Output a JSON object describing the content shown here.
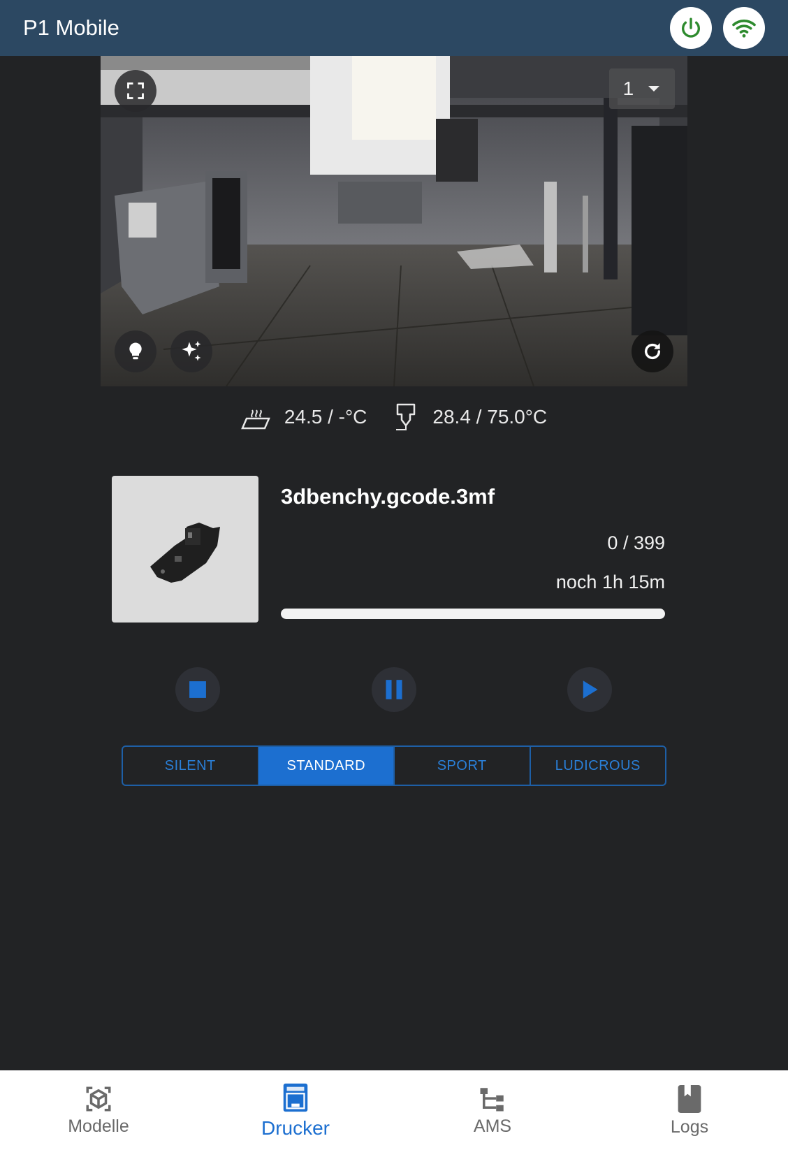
{
  "app": {
    "title": "P1 Mobile"
  },
  "status": {
    "power_icon": "power-icon",
    "wifi_icon": "wifi-icon",
    "color": "#2e8b2e"
  },
  "camera": {
    "selected_camera": "1",
    "buttons": [
      "fullscreen-icon",
      "lightbulb-icon",
      "sparkle-icon",
      "refresh-icon"
    ]
  },
  "temps": {
    "bed": "24.5 / -°C",
    "nozzle": "28.4 / 75.0°C"
  },
  "job": {
    "file_name": "3dbenchy.gcode.3mf",
    "layers": "0 / 399",
    "remaining": "noch 1h 15m",
    "progress": 0
  },
  "controls": [
    "stop-icon",
    "pause-icon",
    "play-icon"
  ],
  "speed": {
    "options": [
      "SILENT",
      "STANDARD",
      "SPORT",
      "LUDICROUS"
    ],
    "selected": "STANDARD"
  },
  "nav": {
    "items": [
      {
        "label": "Modelle",
        "icon": "cube-icon"
      },
      {
        "label": "Drucker",
        "icon": "printer-icon"
      },
      {
        "label": "AMS",
        "icon": "ams-tree-icon"
      },
      {
        "label": "Logs",
        "icon": "book-icon"
      }
    ],
    "active": "Drucker"
  },
  "colors": {
    "accent": "#1c6fd0",
    "topbar": "#2c4862",
    "background": "#222325"
  }
}
